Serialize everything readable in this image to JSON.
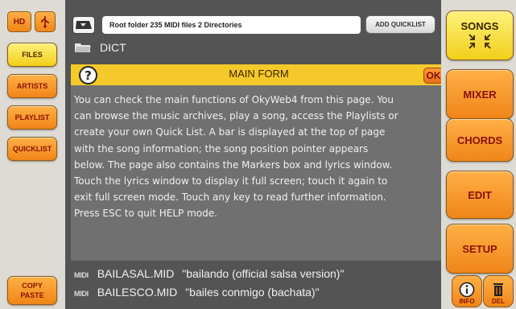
{
  "left_nav": {
    "hd_label": "HD",
    "items": [
      {
        "label": "FILES"
      },
      {
        "label": "ARTISTS"
      },
      {
        "label": "PLAYLIST"
      },
      {
        "label": "QUICKLIST"
      }
    ],
    "copy_paste_lines": [
      "COPY",
      "PASTE"
    ]
  },
  "top_bar": {
    "folder_text": "Root folder 235 MIDI files 2 Directories",
    "add_quicklist_label": "ADD QUICKLIST"
  },
  "file_list": {
    "folder_row": "DICT",
    "rows": [
      {
        "type_label": "MIDI",
        "name": "BAILASAL.MID",
        "title": "\"bailando (official salsa version)\""
      },
      {
        "type_label": "MIDI",
        "name": "BAILESCO.MID",
        "title": "\"bailes conmigo (bachata)\""
      }
    ]
  },
  "dialog": {
    "title": "MAIN FORM",
    "ok_label": "OK",
    "help_glyph": "?",
    "text": "You can check the main functions of OkyWeb4 from this page. You\ncan browse the music archives, play a song, access the Playlists or\ncreate your own Quick List. A bar is displayed at the top of page\nwith the song information; the song position pointer appears\nbelow. The page also contains the Markers box and lyrics window.\nTouch the lyrics window to display it full screen; touch it again to\nexit full screen mode. Touch any key to read further information.\nPress ESC to quit HELP mode."
  },
  "right_nav": {
    "songs_label": "SONGS",
    "buttons": [
      {
        "label": "MIXER"
      },
      {
        "label": "CHORDS"
      },
      {
        "label": "EDIT"
      },
      {
        "label": "SETUP"
      }
    ],
    "info_label": "INFO",
    "del_label": "DEL"
  },
  "colors": {
    "accent_orange": "#f08518",
    "accent_yellow": "#f6c92b",
    "dialog_body": "#707070",
    "background": "#545454"
  }
}
